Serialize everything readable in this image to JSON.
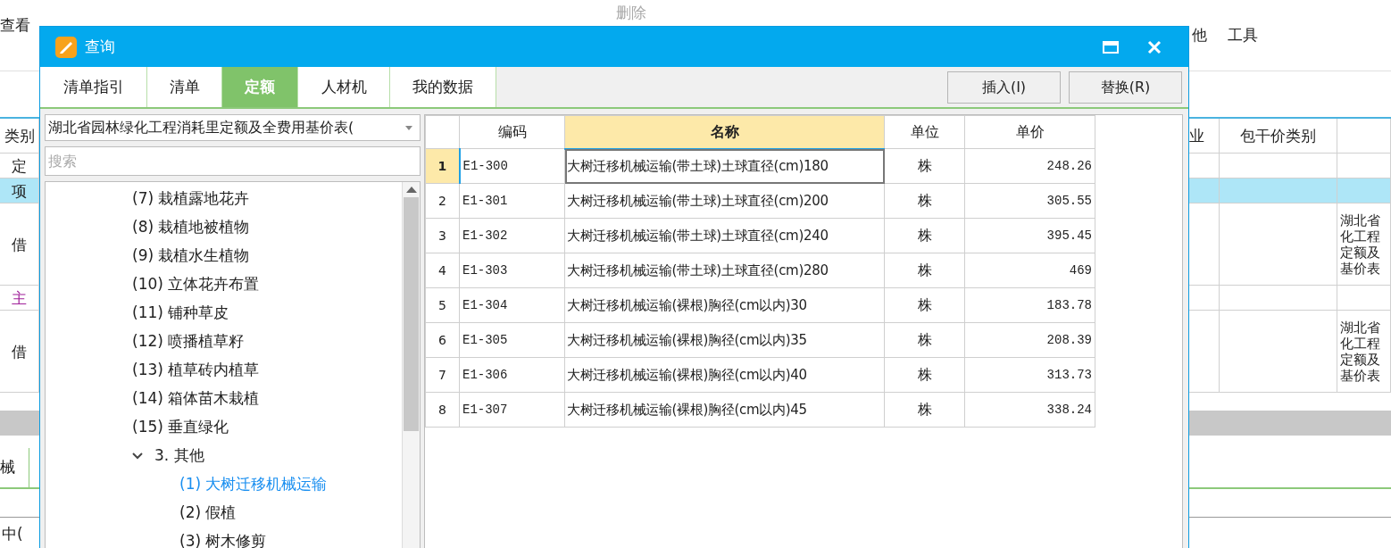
{
  "ribbon": {
    "items": [
      {
        "label": "查看",
        "disabled": false
      },
      {
        "label": "删除",
        "disabled": true
      },
      {
        "label": "他",
        "disabled": false
      },
      {
        "label": "工具",
        "disabled": false
      }
    ]
  },
  "background_table": {
    "columns": [
      "类别",
      "业",
      "包干价类别"
    ],
    "rows": [
      {
        "kind": "normal",
        "selected": false,
        "cells": [
          "定",
          "",
          "",
          ""
        ]
      },
      {
        "kind": "normal",
        "selected": true,
        "cells": [
          "项",
          "",
          "",
          ""
        ]
      },
      {
        "kind": "tall",
        "selected": false,
        "cells": [
          "借",
          "",
          "",
          "湖北省化工程定额及基价表"
        ]
      },
      {
        "kind": "main",
        "selected": false,
        "cells": [
          "主",
          "",
          "",
          ""
        ]
      },
      {
        "kind": "tall",
        "selected": false,
        "cells": [
          "借",
          "",
          "",
          "湖北省化工程定额及基价表"
        ]
      }
    ],
    "lower_labels": [
      "械",
      "中("
    ]
  },
  "dialog": {
    "title": "查询",
    "tabs": [
      {
        "label": "清单指引",
        "selected": false
      },
      {
        "label": "清单",
        "selected": false
      },
      {
        "label": "定额",
        "selected": true
      },
      {
        "label": "人材机",
        "selected": false
      },
      {
        "label": "我的数据",
        "selected": false
      }
    ],
    "buttons": [
      "插入(I)",
      "替换(R)"
    ],
    "library": {
      "value": "湖北省园林绿化工程消耗里定额及全费用基价表("
    },
    "search": {
      "placeholder": "搜索"
    },
    "tree": [
      {
        "children": [
          {
            "label": "(7) 栽植露地花卉",
            "selected": false
          },
          {
            "label": "(8) 栽植地被植物",
            "selected": false
          },
          {
            "label": "(9) 栽植水生植物",
            "selected": false
          },
          {
            "label": "(10) 立体花卉布置",
            "selected": false
          },
          {
            "label": "(11) 铺种草皮",
            "selected": false
          },
          {
            "label": "(12) 喷播植草籽",
            "selected": false
          },
          {
            "label": "(13) 植草砖内植草",
            "selected": false
          },
          {
            "label": "(14) 箱体苗木栽植",
            "selected": false
          },
          {
            "label": "(15) 垂直绿化",
            "selected": false
          }
        ]
      },
      {
        "label": "3. 其他",
        "expanded": true,
        "selected": false,
        "children": [
          {
            "label": "(1) 大树迁移机械运输",
            "selected": true
          },
          {
            "label": "(2) 假植",
            "selected": false
          },
          {
            "label": "(3) 树木修剪",
            "selected": false
          }
        ]
      }
    ],
    "grid": {
      "columns": [
        {
          "label": "编码",
          "selected": false
        },
        {
          "label": "名称",
          "selected": true
        },
        {
          "label": "单位",
          "selected": false
        },
        {
          "label": "单价",
          "selected": false
        }
      ],
      "rows": [
        {
          "number": "1",
          "selected": true,
          "code": "E1-300",
          "name": "大树迁移机械运输(带土球)土球直径(cm)180",
          "unit": "株",
          "price": "248.26"
        },
        {
          "number": "2",
          "selected": false,
          "code": "E1-301",
          "name": "大树迁移机械运输(带土球)土球直径(cm)200",
          "unit": "株",
          "price": "305.55"
        },
        {
          "number": "3",
          "selected": false,
          "code": "E1-302",
          "name": "大树迁移机械运输(带土球)土球直径(cm)240",
          "unit": "株",
          "price": "395.45"
        },
        {
          "number": "4",
          "selected": false,
          "code": "E1-303",
          "name": "大树迁移机械运输(带土球)土球直径(cm)280",
          "unit": "株",
          "price": "469"
        },
        {
          "number": "5",
          "selected": false,
          "code": "E1-304",
          "name": "大树迁移机械运输(裸根)胸径(cm以内)30",
          "unit": "株",
          "price": "183.78"
        },
        {
          "number": "6",
          "selected": false,
          "code": "E1-305",
          "name": "大树迁移机械运输(裸根)胸径(cm以内)35",
          "unit": "株",
          "price": "208.39"
        },
        {
          "number": "7",
          "selected": false,
          "code": "E1-306",
          "name": "大树迁移机械运输(裸根)胸径(cm以内)40",
          "unit": "株",
          "price": "313.73"
        },
        {
          "number": "8",
          "selected": false,
          "code": "E1-307",
          "name": "大树迁移机械运输(裸根)胸径(cm以内)45",
          "unit": "株",
          "price": "338.24"
        }
      ]
    }
  }
}
